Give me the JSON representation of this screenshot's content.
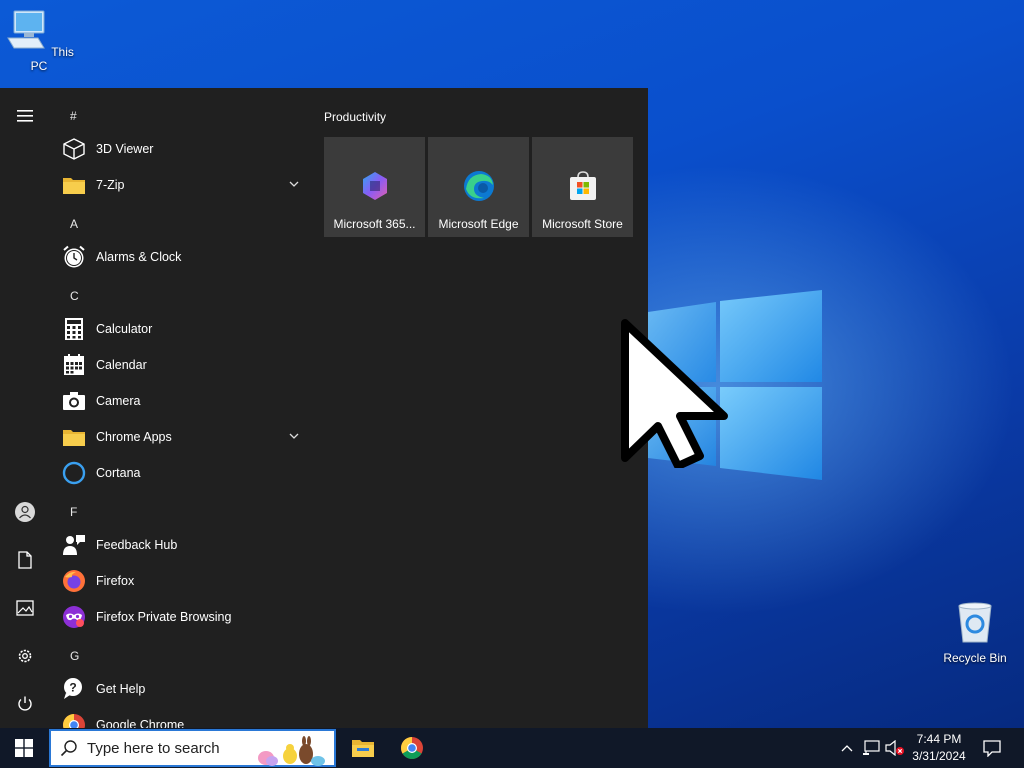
{
  "desktop": {
    "icons": [
      {
        "name": "this-pc",
        "label": "This PC"
      },
      {
        "name": "recycle-bin",
        "label": "Recycle Bin"
      }
    ]
  },
  "start_menu": {
    "rail": [
      "hamburger-icon",
      "user-icon",
      "documents-icon",
      "pictures-icon",
      "settings-icon",
      "power-icon"
    ],
    "groups": {
      "hash": "#",
      "a": "A",
      "c": "C",
      "f": "F",
      "g": "G"
    },
    "apps": {
      "viewer3d": "3D Viewer",
      "zip7": "7-Zip",
      "alarms": "Alarms & Clock",
      "calculator": "Calculator",
      "calendar": "Calendar",
      "camera": "Camera",
      "chrome_apps": "Chrome Apps",
      "cortana": "Cortana",
      "feedback": "Feedback Hub",
      "firefox": "Firefox",
      "firefox_private": "Firefox Private Browsing",
      "get_help": "Get Help",
      "google_chrome": "Google Chrome"
    },
    "tiles_group_title": "Productivity",
    "tiles": [
      {
        "label": "Microsoft 365...",
        "icon": "microsoft-365-icon"
      },
      {
        "label": "Microsoft Edge",
        "icon": "edge-icon"
      },
      {
        "label": "Microsoft Store",
        "icon": "store-icon"
      }
    ]
  },
  "taskbar": {
    "search_placeholder": "Type here to search",
    "pinned": [
      "file-explorer-icon",
      "chrome-icon"
    ],
    "clock_time": "7:44 PM",
    "clock_date": "3/31/2024"
  },
  "colors": {
    "menu_bg": "#202020",
    "tile_bg": "#3b3b3b",
    "taskbar_bg": "#101828",
    "accent": "#2a78d6"
  }
}
